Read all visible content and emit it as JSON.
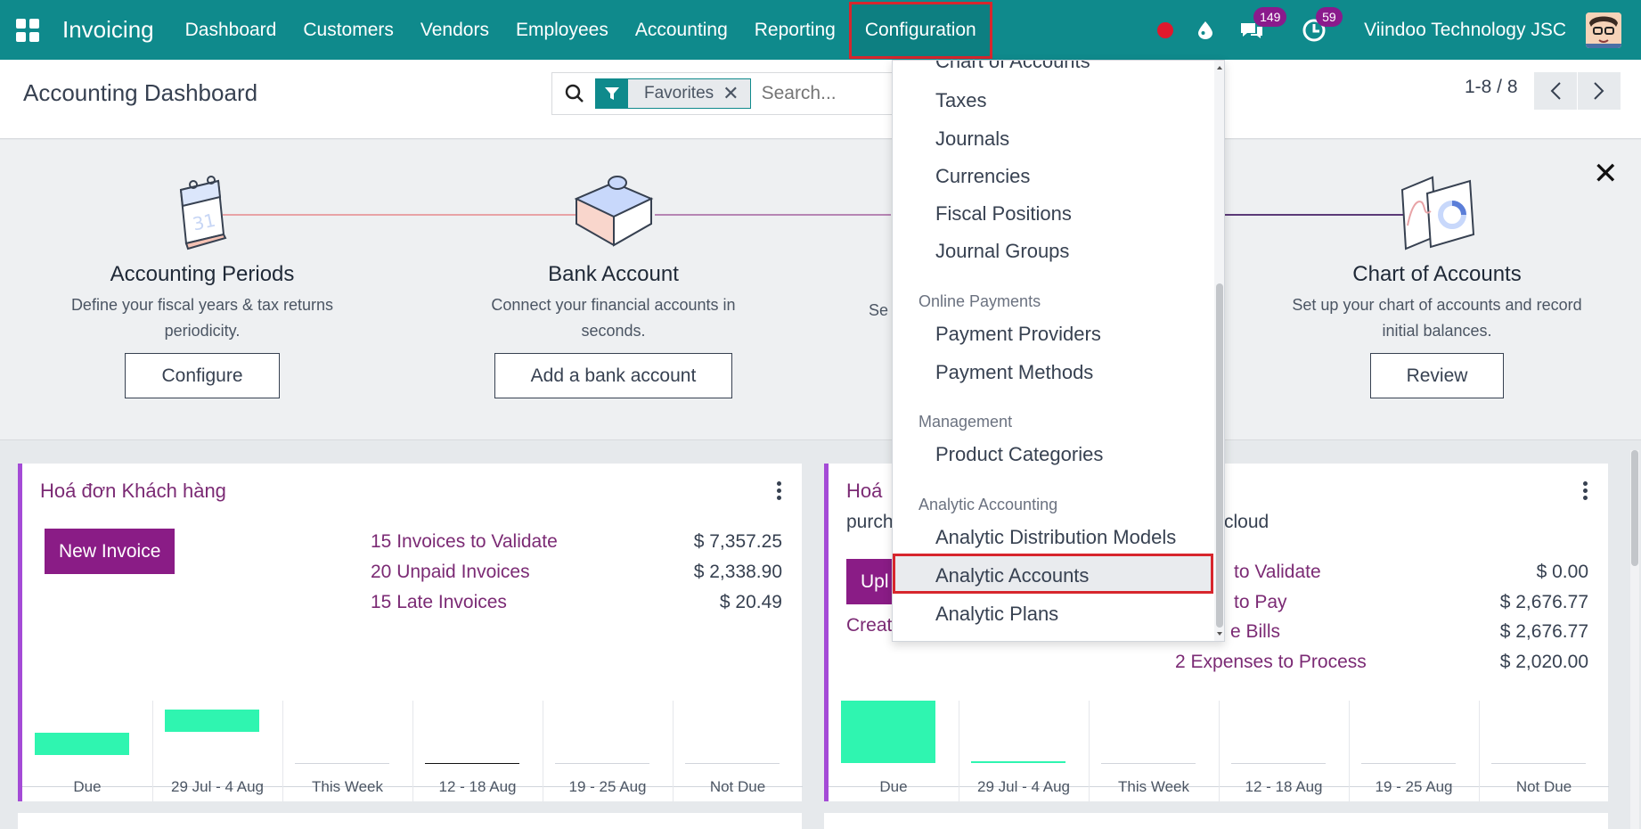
{
  "topbar": {
    "app_name": "Invoicing",
    "nav": [
      "Dashboard",
      "Customers",
      "Vendors",
      "Employees",
      "Accounting",
      "Reporting",
      "Configuration"
    ],
    "active_nav": "Configuration",
    "chat_count": "149",
    "activity_count": "59",
    "company": "Viindoo Technology JSC",
    "colors": {
      "bar": "#0f8a8c",
      "highlight_border": "#d7262d"
    }
  },
  "control": {
    "title": "Accounting Dashboard",
    "facet": "Favorites",
    "search_placeholder": "Search...",
    "pager": "1-8 / 8"
  },
  "onboarding": {
    "steps": [
      {
        "title": "Accounting Periods",
        "desc": "Define your fiscal years & tax returns periodicity.",
        "button": "Configure"
      },
      {
        "title": "Bank Account",
        "desc": "Connect your financial accounts in seconds.",
        "button": "Add a bank account"
      },
      {
        "title": "Chart of Accounts",
        "desc": "Set up your chart of accounts and record initial balances.",
        "button": "Review"
      }
    ],
    "hidden_desc_fragment": "Se"
  },
  "card1": {
    "title": "Hoá đơn Khách hàng",
    "button": "New Invoice",
    "stats": [
      {
        "label": "15 Invoices to Validate",
        "value": "$ 7,357.25"
      },
      {
        "label": "20 Unpaid Invoices",
        "value": "$ 2,338.90"
      },
      {
        "label": "15 Late Invoices",
        "value": "$ 20.49"
      }
    ],
    "chart_data": {
      "type": "bar",
      "categories": [
        "Due",
        "29 Jul - 4 Aug",
        "This Week",
        "12 - 18 Aug",
        "19 - 25 Aug",
        "Not Due"
      ],
      "values": [
        0.35,
        0.35,
        0,
        0,
        0,
        0
      ]
    }
  },
  "card2": {
    "title": "Hoá",
    "subtitle_start": "purch",
    "subtitle_end": "cloud",
    "button": "Upl",
    "create_link": "Creat",
    "stats": [
      {
        "label": "to Validate",
        "value": "$ 0.00"
      },
      {
        "label": "to Pay",
        "value": "$ 2,676.77"
      },
      {
        "label": "e Bills",
        "value": "$ 2,676.77"
      },
      {
        "label": "2 Expenses to Process",
        "value": "$ 2,020.00"
      }
    ],
    "chart_data": {
      "type": "bar",
      "categories": [
        "Due",
        "29 Jul - 4 Aug",
        "This Week",
        "12 - 18 Aug",
        "19 - 25 Aug",
        "Not Due"
      ],
      "values": [
        1.0,
        0.03,
        0,
        0,
        0,
        0
      ]
    }
  },
  "dropdown": {
    "partial_top": "Chart of Accounts",
    "items": [
      {
        "kind": "item",
        "label": "Taxes"
      },
      {
        "kind": "item",
        "label": "Journals"
      },
      {
        "kind": "item",
        "label": "Currencies"
      },
      {
        "kind": "item",
        "label": "Fiscal Positions"
      },
      {
        "kind": "item",
        "label": "Journal Groups"
      },
      {
        "kind": "header",
        "label": "Online Payments"
      },
      {
        "kind": "item",
        "label": "Payment Providers"
      },
      {
        "kind": "item",
        "label": "Payment Methods"
      },
      {
        "kind": "header",
        "label": "Management"
      },
      {
        "kind": "item",
        "label": "Product Categories"
      },
      {
        "kind": "header",
        "label": "Analytic Accounting"
      },
      {
        "kind": "item",
        "label": "Analytic Distribution Models"
      },
      {
        "kind": "item",
        "label": "Analytic Accounts",
        "selected": true
      },
      {
        "kind": "item",
        "label": "Analytic Plans"
      }
    ]
  }
}
